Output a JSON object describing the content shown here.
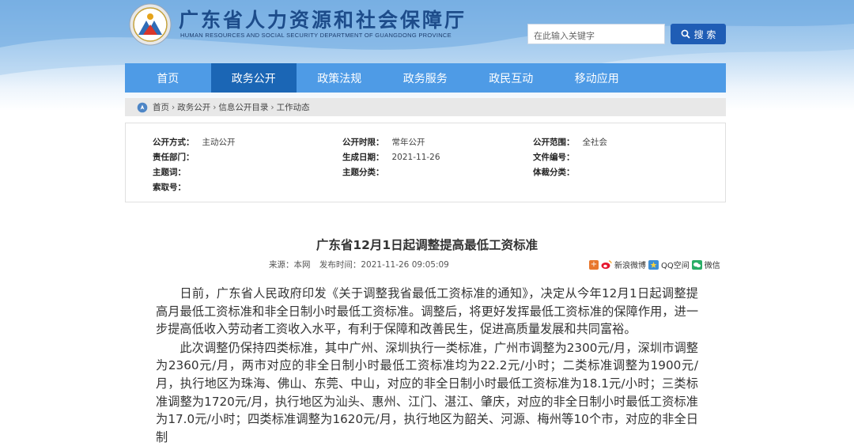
{
  "header": {
    "title_cn": "广东省人力资源和社会保障厅",
    "title_en": "HUMAN RESOURCES AND SOCIAL SECURITY DEPARTMENT OF GUANGDONG PROVINCE",
    "search_placeholder": "在此输入关键字",
    "search_button": "搜 索"
  },
  "nav": {
    "items": [
      "首页",
      "政务公开",
      "政策法规",
      "政务服务",
      "政民互动",
      "移动应用"
    ],
    "active_index": 1
  },
  "breadcrumb": {
    "items": [
      "首页",
      "政务公开",
      "信息公开目录",
      "工作动态"
    ],
    "separator": "›"
  },
  "meta": {
    "col1": [
      {
        "label": "公开方式：",
        "value": "主动公开"
      },
      {
        "label": "责任部门：",
        "value": ""
      },
      {
        "label": "主题词：",
        "value": ""
      },
      {
        "label": "索取号：",
        "value": ""
      }
    ],
    "col2": [
      {
        "label": "公开时限：",
        "value": "常年公开"
      },
      {
        "label": "生成日期：",
        "value": "2021-11-26"
      },
      {
        "label": "主题分类：",
        "value": ""
      }
    ],
    "col3": [
      {
        "label": "公开范围：",
        "value": "全社会"
      },
      {
        "label": "文件编号：",
        "value": ""
      },
      {
        "label": "体裁分类：",
        "value": ""
      }
    ]
  },
  "article": {
    "title": "广东省12月1日起调整提高最低工资标准",
    "source": "来源：本网",
    "publish_time": "发布时间：2021-11-26 09:05:09",
    "share": {
      "weibo": "新浪微博",
      "qzone": "QQ空间",
      "wechat": "微信"
    },
    "paragraphs": [
      "日前，广东省人民政府印发《关于调整我省最低工资标准的通知》，决定从今年12月1日起调整提高月最低工资标准和非全日制小时最低工资标准。调整后，将更好发挥最低工资标准的保障作用，进一步提高低收入劳动者工资收入水平，有利于保障和改善民生，促进高质量发展和共同富裕。",
      "此次调整仍保持四类标准，其中广州、深圳执行一类标准，广州市调整为2300元/月，深圳市调整为2360元/月，两市对应的非全日制小时最低工资标准均为22.2元/小时；二类标准调整为1900元/月，执行地区为珠海、佛山、东莞、中山，对应的非全日制小时最低工资标准为18.1元/小时；三类标准调整为1720元/月，执行地区为汕头、惠州、江门、湛江、肇庆，对应的非全日制小时最低工资标准为17.0元/小时；四类标准调整为1620元/月，执行地区为韶关、河源、梅州等10个市，对应的非全日制"
    ]
  },
  "colors": {
    "nav_bg": "#4e9be6",
    "nav_active": "#1b66b5",
    "search_button": "#1f5db5",
    "title_blue": "#1d4c8a"
  }
}
